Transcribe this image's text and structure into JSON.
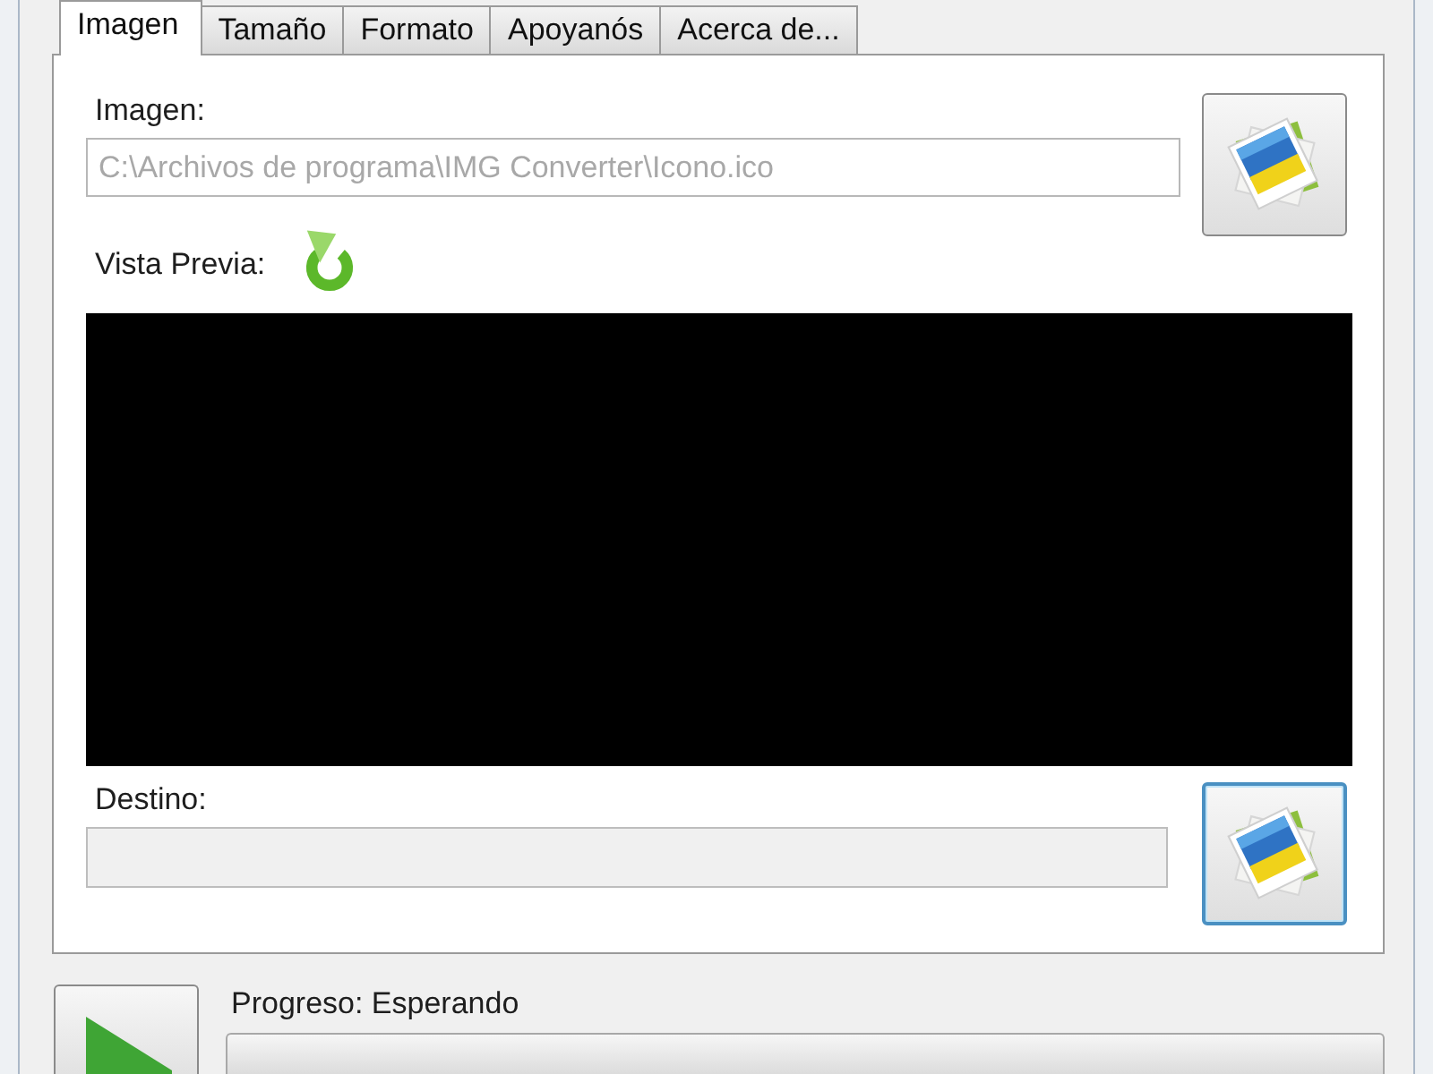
{
  "tabs": [
    {
      "label": "Imagen",
      "selected": true
    },
    {
      "label": "Tamaño",
      "selected": false
    },
    {
      "label": "Formato",
      "selected": false
    },
    {
      "label": "Apoyanós",
      "selected": false
    },
    {
      "label": "Acerca de...",
      "selected": false
    }
  ],
  "image": {
    "label": "Imagen:",
    "placeholder": "C:\\Archivos de programa\\IMG Converter\\Icono.ico",
    "browse_button": {
      "focused": false
    }
  },
  "preview": {
    "label": "Vista Previa:"
  },
  "destination": {
    "label": "Destino:",
    "disabled": true,
    "browse_button": {
      "focused": true
    }
  },
  "progress": {
    "label": "Progreso: Esperando",
    "level": 0
  }
}
